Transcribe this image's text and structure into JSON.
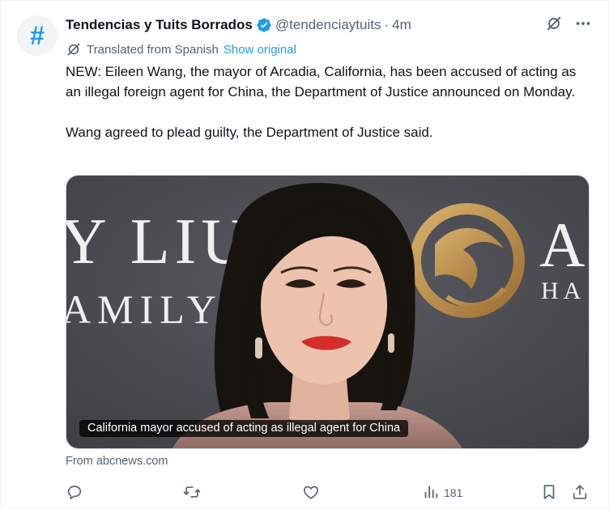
{
  "author": {
    "name": "Tendencias y Tuits Borrados",
    "handle": "@tendenciaytuits",
    "separator": "·",
    "time": "4m",
    "avatar_glyph": "#"
  },
  "translation": {
    "label": "Translated from Spanish",
    "show_original": "Show original"
  },
  "text": {
    "paragraph1": "NEW: Eileen Wang, the mayor of Arcadia, California, has been accused of acting as an illegal foreign agent for China, the Department of Justice announced on Monday.",
    "paragraph2": "Wang agreed to plead guilty, the Department of Justice said."
  },
  "card": {
    "caption": "California mayor accused of acting as illegal agent for China",
    "source": "From abcnews.com",
    "backdrop_text_line1": "Y LIU",
    "backdrop_text_line2": "AMILY",
    "backdrop_logo_text1": "A",
    "backdrop_logo_text2": "HA"
  },
  "actions": {
    "views": "181"
  },
  "icons": {
    "verified": "verified-badge-icon",
    "grok": "grok-icon",
    "more": "more-icon",
    "translate": "translate-icon",
    "reply": "reply-icon",
    "retweet": "retweet-icon",
    "like": "like-icon",
    "views": "views-icon",
    "bookmark": "bookmark-icon",
    "share": "share-icon"
  },
  "colors": {
    "accent": "#1d9bf0",
    "secondary_text": "#536471",
    "primary_text": "#0f1419",
    "card_background": "#4d4e52",
    "logo_gold": "#b88a4a"
  }
}
